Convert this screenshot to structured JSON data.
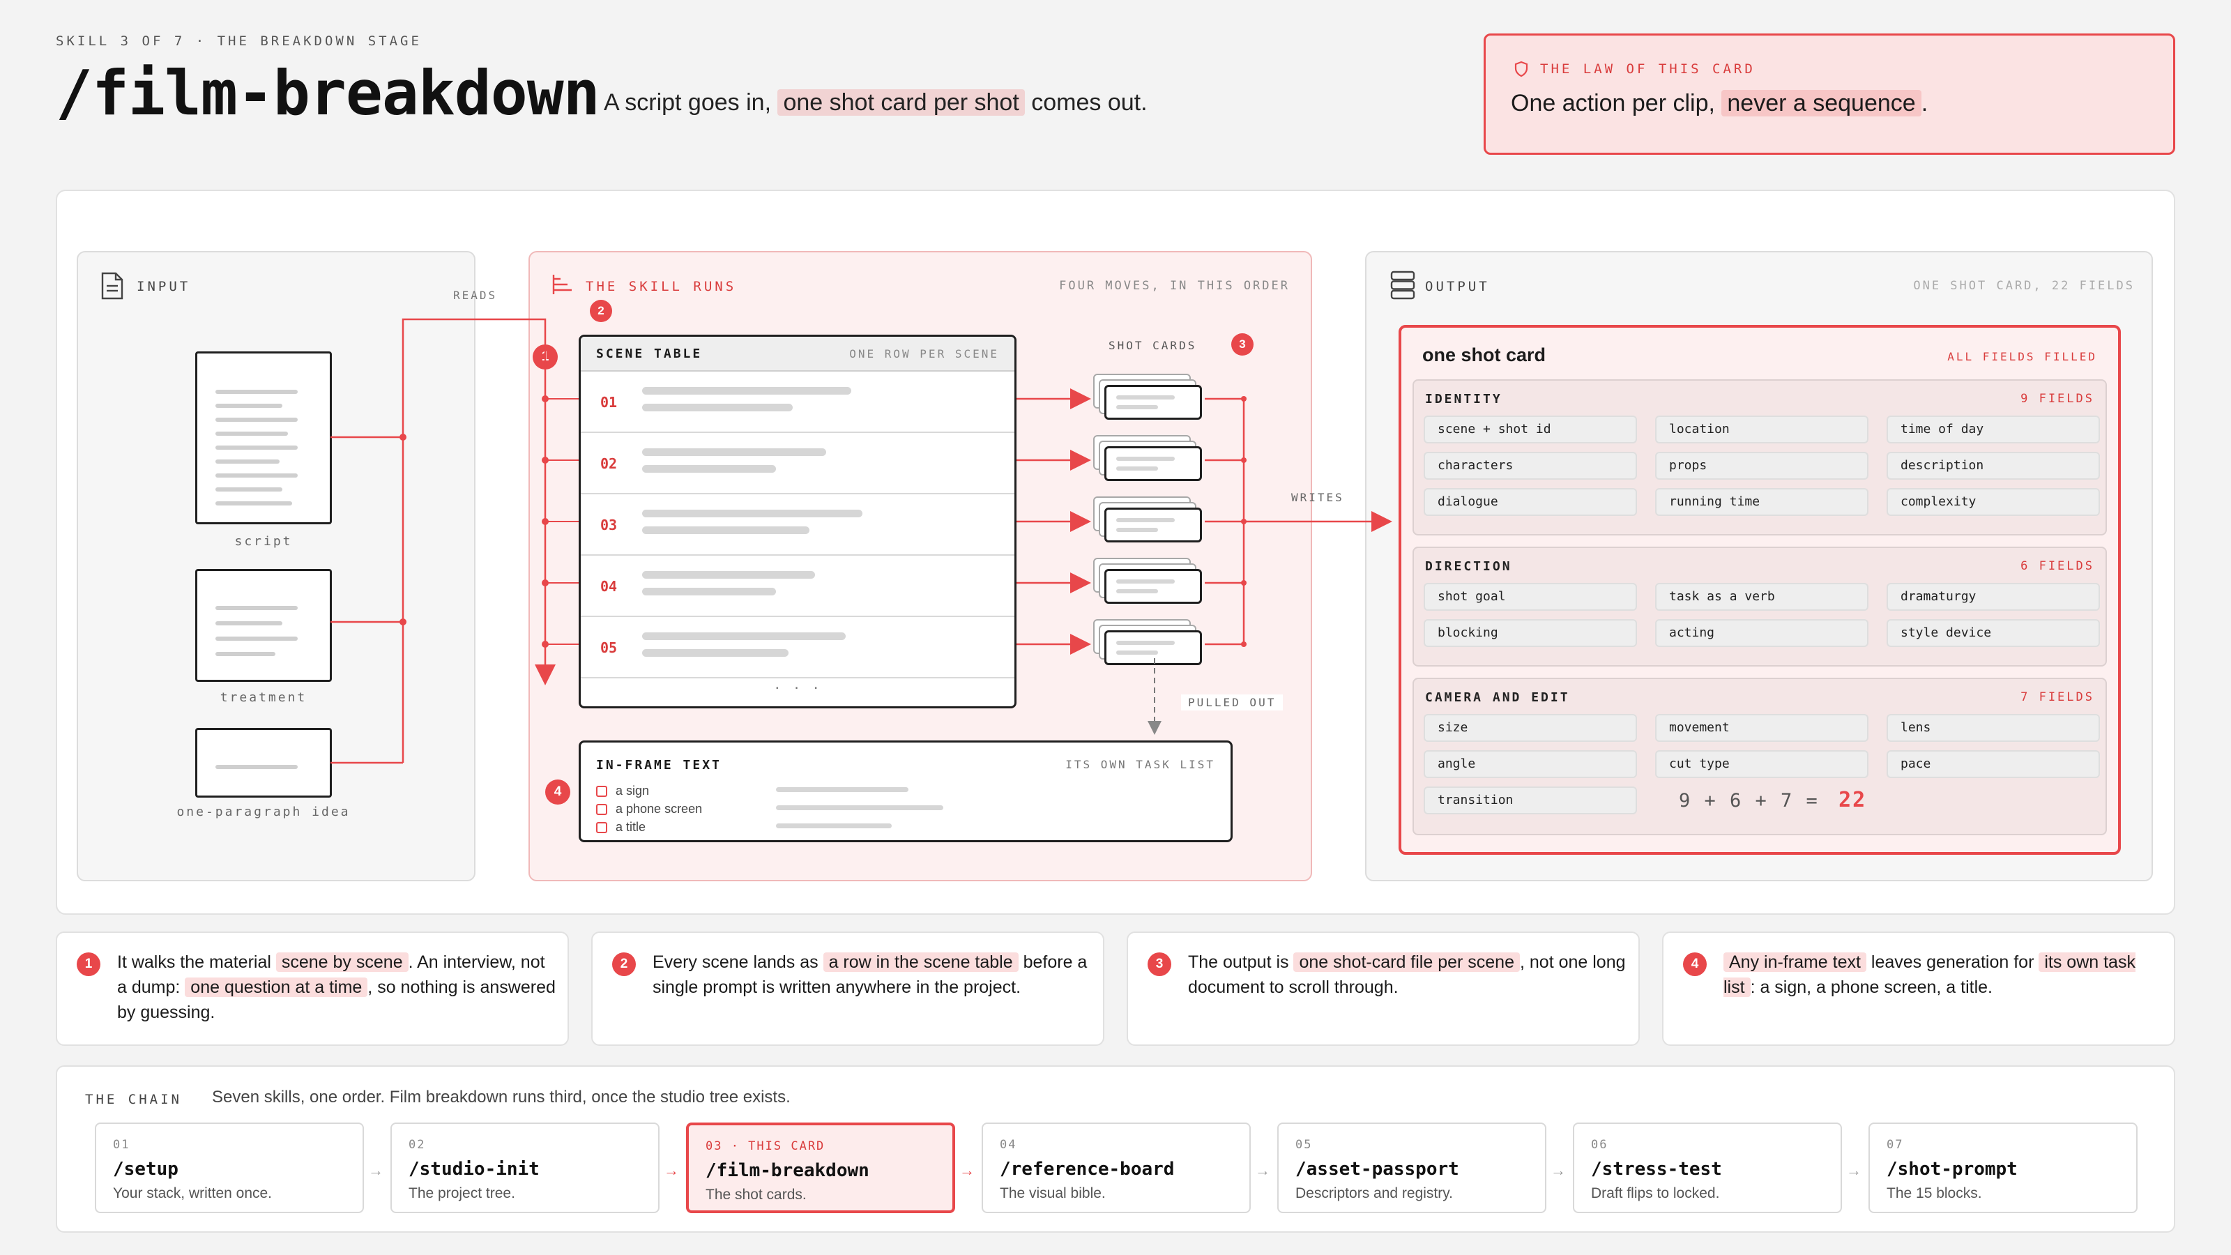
{
  "header": {
    "eyebrow": "SKILL 3 OF 7 · THE BREAKDOWN STAGE",
    "title": "/film-breakdown",
    "tagline_pre": "A script goes in,",
    "tagline_hl": "one shot card per shot",
    "tagline_post": "comes out."
  },
  "law": {
    "label": "THE LAW OF THIS CARD",
    "text_pre": "One action per clip,",
    "text_hl": "never a sequence",
    "text_post": "."
  },
  "input": {
    "label": "INPUT",
    "reads": "READS",
    "docs": [
      "script",
      "treatment",
      "one-paragraph idea"
    ]
  },
  "skill": {
    "label": "THE SKILL RUNS",
    "sub": "FOUR MOVES, IN THIS ORDER",
    "badges": [
      "1",
      "2",
      "3",
      "4"
    ],
    "scene_table": {
      "title": "SCENE TABLE",
      "sub": "ONE ROW PER SCENE",
      "rows": [
        "01",
        "02",
        "03",
        "04",
        "05"
      ],
      "more": "· · ·"
    },
    "shot_cards_label": "SHOT CARDS",
    "writes": "WRITES",
    "pulled_out": "PULLED OUT",
    "inframe": {
      "title": "IN-FRAME TEXT",
      "sub": "ITS OWN TASK LIST",
      "items": [
        "a sign",
        "a phone screen",
        "a title"
      ]
    }
  },
  "output": {
    "label": "OUTPUT",
    "sub": "ONE SHOT CARD, 22 FIELDS",
    "card_title": "one shot card",
    "card_status": "ALL FIELDS FILLED",
    "groups": [
      {
        "title": "IDENTITY",
        "count": "9 FIELDS",
        "fields": [
          "scene + shot id",
          "location",
          "time of day",
          "characters",
          "props",
          "description",
          "dialogue",
          "running time",
          "complexity"
        ]
      },
      {
        "title": "DIRECTION",
        "count": "6 FIELDS",
        "fields": [
          "shot goal",
          "task as a verb",
          "dramaturgy",
          "blocking",
          "acting",
          "style device"
        ]
      },
      {
        "title": "CAMERA AND EDIT",
        "count": "7 FIELDS",
        "fields": [
          "size",
          "movement",
          "lens",
          "angle",
          "cut type",
          "pace",
          "transition"
        ]
      }
    ],
    "sum": "9 + 6 + 7 =",
    "total": "22"
  },
  "notes": [
    {
      "num": "1",
      "a": "It walks the material",
      "b": "scene by scene",
      "c": ". An interview, not a dump:",
      "d": "one question at a time",
      "e": ", so nothing is answered by guessing."
    },
    {
      "num": "2",
      "a": "Every scene lands as",
      "b": "a row in the scene table",
      "c": "before a single prompt is written anywhere in the project.",
      "d": "",
      "e": ""
    },
    {
      "num": "3",
      "a": "The output is",
      "b": "one shot-card file per scene",
      "c": ", not one long document to scroll through.",
      "d": "",
      "e": ""
    },
    {
      "num": "4",
      "a": "",
      "b": "Any in-frame text",
      "c": "leaves generation for",
      "d": "its own task list",
      "e": ": a sign, a phone screen, a title."
    }
  ],
  "chain": {
    "label": "THE CHAIN",
    "desc": "Seven skills, one order. Film breakdown runs third, once the studio tree exists.",
    "steps": [
      {
        "num": "01",
        "name": "/setup",
        "desc": "Your stack, written once."
      },
      {
        "num": "02",
        "name": "/studio-init",
        "desc": "The project tree."
      },
      {
        "num": "03 · THIS CARD",
        "name": "/film-breakdown",
        "desc": "The shot cards."
      },
      {
        "num": "04",
        "name": "/reference-board",
        "desc": "The visual bible."
      },
      {
        "num": "05",
        "name": "/asset-passport",
        "desc": "Descriptors and registry."
      },
      {
        "num": "06",
        "name": "/stress-test",
        "desc": "Draft flips to locked."
      },
      {
        "num": "07",
        "name": "/shot-prompt",
        "desc": "The 15 blocks."
      }
    ]
  },
  "colors": {
    "accent": "#e8474a",
    "accent_bg": "#fbe3e3",
    "ink": "#1f1f1f"
  }
}
